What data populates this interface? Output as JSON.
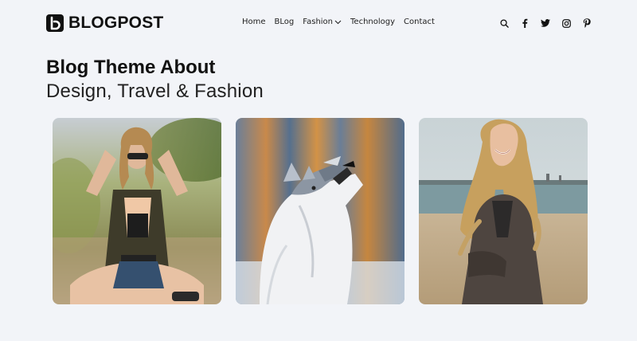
{
  "brand": {
    "logo_letter": "b",
    "name": "BLOGPOST"
  },
  "nav": {
    "items": [
      {
        "label": "Home"
      },
      {
        "label": "BLog"
      },
      {
        "label": "Fashion",
        "has_dropdown": true
      },
      {
        "label": "Technology"
      },
      {
        "label": "Contact"
      }
    ]
  },
  "header_icons": [
    "search-icon",
    "facebook-icon",
    "twitter-icon",
    "instagram-icon",
    "pinterest-icon"
  ],
  "hero": {
    "title": "Blog Theme About",
    "subtitle": "Design, Travel & Fashion"
  },
  "cards": [
    {
      "image": "woman-sitting-on-railway-photo"
    },
    {
      "image": "husky-dog-howling-photo"
    },
    {
      "image": "woman-on-beach-photo"
    }
  ],
  "colors": {
    "background": "#f2f4f8",
    "text": "#111111"
  }
}
